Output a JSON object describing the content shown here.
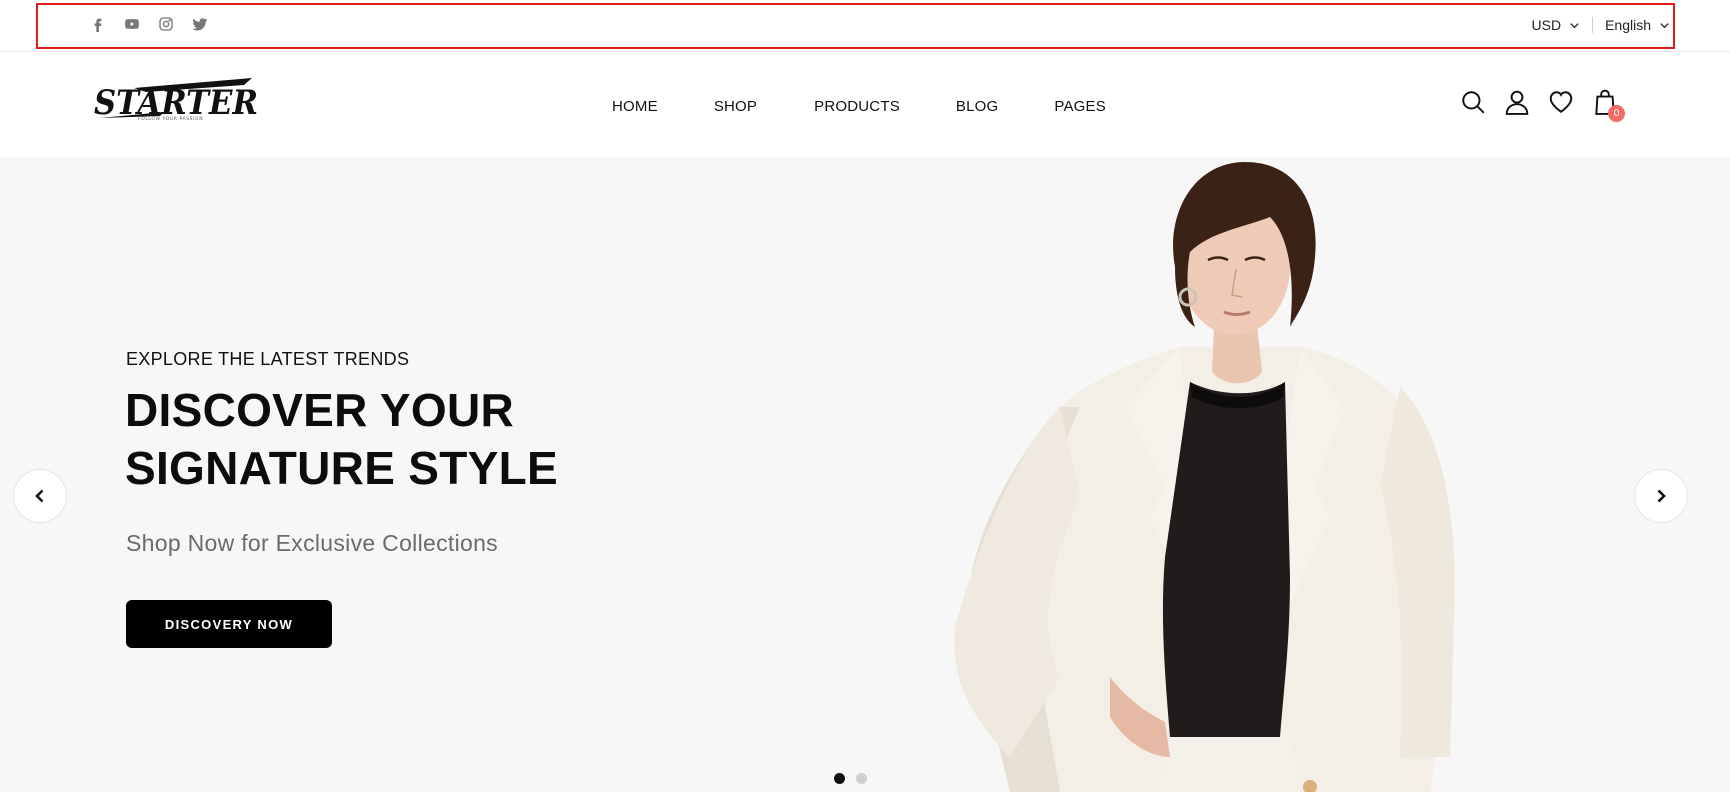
{
  "topbar": {
    "social_icons": [
      "facebook-icon",
      "youtube-icon",
      "instagram-icon",
      "twitter-icon"
    ],
    "currency": "USD",
    "language": "English"
  },
  "header": {
    "logo_text": "STARTER",
    "logo_tagline": "FOLLOW YOUR PASSION",
    "nav": {
      "home": "HOME",
      "shop": "SHOP",
      "products": "PRODUCTS",
      "blog": "BLOG",
      "pages": "PAGES"
    },
    "icons": [
      "search-icon",
      "user-icon",
      "heart-icon",
      "bag-icon"
    ],
    "cart_count": "0"
  },
  "hero": {
    "eyebrow": "EXPLORE THE LATEST TRENDS",
    "headline_line1": "DISCOVER YOUR",
    "headline_line2": "SIGNATURE STYLE",
    "subline": "Shop Now for Exclusive Collections",
    "cta": "DISCOVERY NOW",
    "slides_total": 2,
    "active_slide": 1
  },
  "colors": {
    "highlight_border": "#e01b1b",
    "cart_badge": "#f46a64",
    "hero_bg": "#f7f7f7",
    "cta_bg": "#000000"
  }
}
